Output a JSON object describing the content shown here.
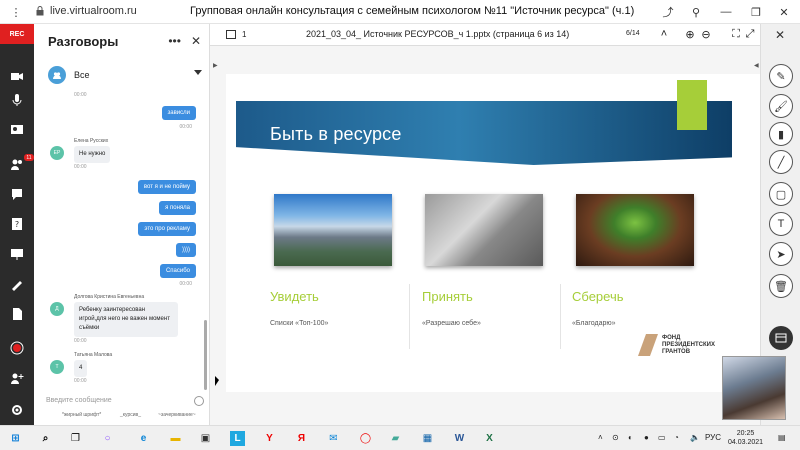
{
  "browser": {
    "url": "live.virtualroom.ru",
    "window_title": "Групповая онлайн консультация с семейным психологом №11 \"Источник ресурса\" (ч.1)"
  },
  "leftbar": {
    "rec_label": "REC",
    "badge_count": "11"
  },
  "chat": {
    "title": "Разговоры",
    "room_name": "Все",
    "messages": [
      {
        "dir": "out",
        "text": "зависли",
        "time": "00:00"
      },
      {
        "dir": "in",
        "sender": "Елена Русских",
        "initials": "ЕР",
        "text": "Не нужно",
        "time": "00:00"
      },
      {
        "dir": "out",
        "text": "вот я и не пойму"
      },
      {
        "dir": "out",
        "text": "я поняла"
      },
      {
        "dir": "out",
        "text": "это про рекламу"
      },
      {
        "dir": "out",
        "text": "))))"
      },
      {
        "dir": "out",
        "text": "Спасибо",
        "time": "00:00"
      },
      {
        "dir": "in",
        "sender": "Долгова Кристина Евгеньевна",
        "initials": "Д",
        "text": "Ребенку заинтересован игрой,для него не важен момент съёмки",
        "time": "00:00"
      },
      {
        "dir": "in",
        "sender": "Татьяна Малова",
        "initials": "Т",
        "text": "4",
        "time": "00:00"
      }
    ],
    "composer_placeholder": "Введите сообщение",
    "format_bold": "*жирный шрифт*",
    "format_italic": "_курсив_",
    "format_strike": "~зачеркивание~"
  },
  "viewer": {
    "pages_count": "1",
    "doc_title": "2021_03_04_ Источник РЕСУРСОВ_ч 1.pptx (страница 6 из 14)",
    "page_indicator": "6/14"
  },
  "slide": {
    "title": "Быть в ресурсе",
    "columns": [
      {
        "heading": "Увидеть",
        "sub": "Списки «Топ-100»"
      },
      {
        "heading": "Принять",
        "sub": "«Разрешаю себе»"
      },
      {
        "heading": "Сберечь",
        "sub": "«Благодарю»"
      }
    ],
    "fund_lines": [
      "ФОНД",
      "ПРЕЗИДЕНТСКИХ",
      "ГРАНТОВ"
    ],
    "accent_color": "#a6ce39"
  },
  "taskbar": {
    "lang": "РУС",
    "time": "20:25",
    "date": "04.03.2021"
  }
}
